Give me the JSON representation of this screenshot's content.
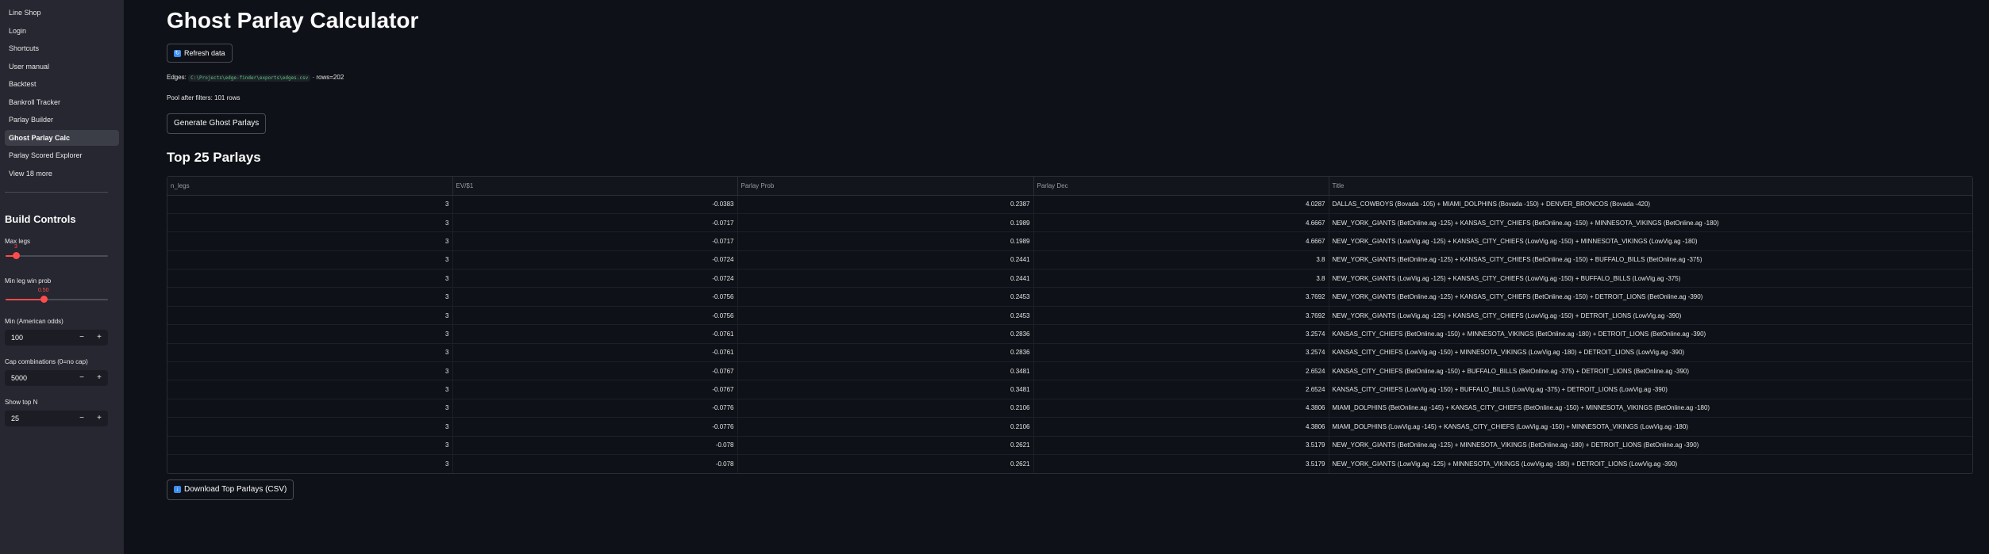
{
  "sidebar": {
    "nav": [
      "Line Shop",
      "Login",
      "Shortcuts",
      "User manual",
      "Backtest",
      "Bankroll Tracker",
      "Parlay Builder",
      "Ghost Parlay Calc",
      "Parlay Scored Explorer"
    ],
    "active_index": 7,
    "view_more": "View 18 more",
    "header": "Build Controls",
    "max_legs": {
      "label": "Max legs",
      "value": "3",
      "fraction": 0.1
    },
    "min_leg_win_prob": {
      "label": "Min leg win prob",
      "value": "0.50",
      "fraction": 0.37
    },
    "min_american_odds": {
      "label": "Min (American odds)",
      "value": "100"
    },
    "cap_combinations": {
      "label": "Cap combinations (0=no cap)",
      "value": "5000"
    },
    "show_top_n": {
      "label": "Show top N",
      "value": "25"
    },
    "minus": "−",
    "plus": "+"
  },
  "main": {
    "title": "Ghost Parlay Calculator",
    "refresh_button": "Refresh data",
    "edges_label": "Edges:",
    "edges_path": "C:\\Projects\\edge-finder\\exports\\edges.csv",
    "edges_rows": "· rows=202",
    "pool_text": "Pool after filters: 101 rows",
    "generate_button": "Generate Ghost Parlays",
    "subheader": "Top 25 Parlays",
    "download_button": "Download Top Parlays (CSV)"
  },
  "table": {
    "columns": [
      "n_legs",
      "EV/$1",
      "Parlay Prob",
      "Parlay Dec",
      "Title"
    ],
    "rows": [
      [
        "3",
        "-0.0383",
        "0.2387",
        "4.0287",
        "DALLAS_COWBOYS (Bovada -105) + MIAMI_DOLPHINS (Bovada -150) + DENVER_BRONCOS (Bovada -420)"
      ],
      [
        "3",
        "-0.0717",
        "0.1989",
        "4.6667",
        "NEW_YORK_GIANTS (BetOnline.ag -125) + KANSAS_CITY_CHIEFS (BetOnline.ag -150) + MINNESOTA_VIKINGS (BetOnline.ag -180)"
      ],
      [
        "3",
        "-0.0717",
        "0.1989",
        "4.6667",
        "NEW_YORK_GIANTS (LowVig.ag -125) + KANSAS_CITY_CHIEFS (LowVig.ag -150) + MINNESOTA_VIKINGS (LowVig.ag -180)"
      ],
      [
        "3",
        "-0.0724",
        "0.2441",
        "3.8",
        "NEW_YORK_GIANTS (BetOnline.ag -125) + KANSAS_CITY_CHIEFS (BetOnline.ag -150) + BUFFALO_BILLS (BetOnline.ag -375)"
      ],
      [
        "3",
        "-0.0724",
        "0.2441",
        "3.8",
        "NEW_YORK_GIANTS (LowVig.ag -125) + KANSAS_CITY_CHIEFS (LowVig.ag -150) + BUFFALO_BILLS (LowVig.ag -375)"
      ],
      [
        "3",
        "-0.0756",
        "0.2453",
        "3.7692",
        "NEW_YORK_GIANTS (BetOnline.ag -125) + KANSAS_CITY_CHIEFS (BetOnline.ag -150) + DETROIT_LIONS (BetOnline.ag -390)"
      ],
      [
        "3",
        "-0.0756",
        "0.2453",
        "3.7692",
        "NEW_YORK_GIANTS (LowVig.ag -125) + KANSAS_CITY_CHIEFS (LowVig.ag -150) + DETROIT_LIONS (LowVig.ag -390)"
      ],
      [
        "3",
        "-0.0761",
        "0.2836",
        "3.2574",
        "KANSAS_CITY_CHIEFS (BetOnline.ag -150) + MINNESOTA_VIKINGS (BetOnline.ag -180) + DETROIT_LIONS (BetOnline.ag -390)"
      ],
      [
        "3",
        "-0.0761",
        "0.2836",
        "3.2574",
        "KANSAS_CITY_CHIEFS (LowVig.ag -150) + MINNESOTA_VIKINGS (LowVig.ag -180) + DETROIT_LIONS (LowVig.ag -390)"
      ],
      [
        "3",
        "-0.0767",
        "0.3481",
        "2.6524",
        "KANSAS_CITY_CHIEFS (BetOnline.ag -150) + BUFFALO_BILLS (BetOnline.ag -375) + DETROIT_LIONS (BetOnline.ag -390)"
      ],
      [
        "3",
        "-0.0767",
        "0.3481",
        "2.6524",
        "KANSAS_CITY_CHIEFS (LowVig.ag -150) + BUFFALO_BILLS (LowVig.ag -375) + DETROIT_LIONS (LowVig.ag -390)"
      ],
      [
        "3",
        "-0.0776",
        "0.2106",
        "4.3806",
        "MIAMI_DOLPHINS (BetOnline.ag -145) + KANSAS_CITY_CHIEFS (BetOnline.ag -150) + MINNESOTA_VIKINGS (BetOnline.ag -180)"
      ],
      [
        "3",
        "-0.0776",
        "0.2106",
        "4.3806",
        "MIAMI_DOLPHINS (LowVig.ag -145) + KANSAS_CITY_CHIEFS (LowVig.ag -150) + MINNESOTA_VIKINGS (LowVig.ag -180)"
      ],
      [
        "3",
        "-0.078",
        "0.2621",
        "3.5179",
        "NEW_YORK_GIANTS (BetOnline.ag -125) + MINNESOTA_VIKINGS (BetOnline.ag -180) + DETROIT_LIONS (BetOnline.ag -390)"
      ],
      [
        "3",
        "-0.078",
        "0.2621",
        "3.5179",
        "NEW_YORK_GIANTS (LowVig.ag -125) + MINNESOTA_VIKINGS (LowVig.ag -180) + DETROIT_LIONS (LowVig.ag -390)"
      ]
    ]
  },
  "colors": {
    "accent": "#ff4b4b",
    "background": "#0e1117",
    "sidebar": "#262730"
  }
}
